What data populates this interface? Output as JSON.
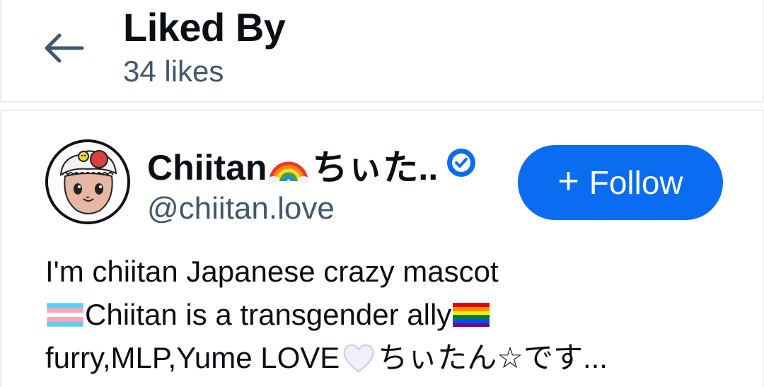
{
  "header": {
    "title": "Liked By",
    "subtitle": "34 likes",
    "back_icon": "arrow-left-icon"
  },
  "user": {
    "display_name": "Chiitan",
    "display_name_suffix": "ちぃた..",
    "handle": "@chiitan.love",
    "verified": true,
    "avatar_icon": "chiitan-mascot-avatar",
    "follow_button": {
      "plus": "+",
      "label": "Follow"
    },
    "bio": {
      "line1": "I'm chiitan Japanese crazy mascot",
      "line2": "Chiitan is a transgender ally",
      "line3a": "furry,MLP,Yume LOVE",
      "line3b": "ちぃたん☆です..."
    }
  },
  "colors": {
    "accent": "#0a6cf0",
    "text_primary": "#0b0f14",
    "text_secondary": "#42576c",
    "divider": "#e9edf1"
  }
}
